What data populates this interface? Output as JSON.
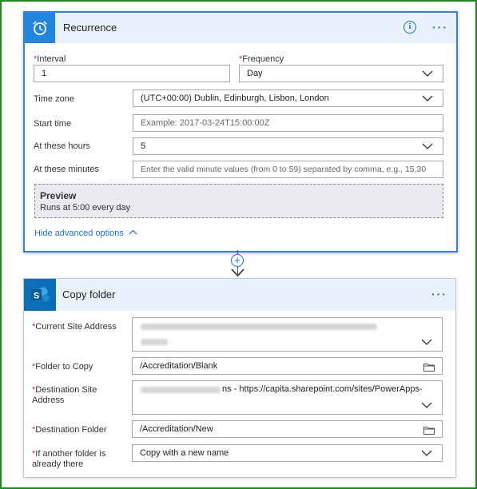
{
  "recurrence": {
    "title": "Recurrence",
    "more_label": "···",
    "info_label": "i",
    "interval": {
      "label": "Interval",
      "value": "1"
    },
    "frequency": {
      "label": "Frequency",
      "value": "Day"
    },
    "time_zone": {
      "label": "Time zone",
      "value": "(UTC+00:00) Dublin, Edinburgh, Lisbon, London"
    },
    "start_time": {
      "label": "Start time",
      "placeholder": "Example: 2017-03-24T15:00:00Z"
    },
    "at_hours": {
      "label": "At these hours",
      "value": "5"
    },
    "at_minutes": {
      "label": "At these minutes",
      "placeholder": "Enter the valid minute values (from 0 to 59) separated by comma, e.g., 15,30"
    },
    "preview": {
      "title": "Preview",
      "text": "Runs at 5:00 every day"
    },
    "advanced_link": "Hide advanced options"
  },
  "connector": {
    "add_label": "+"
  },
  "copy_folder": {
    "title": "Copy folder",
    "more_label": "···",
    "current_site": {
      "label": "Current Site Address"
    },
    "folder_to_copy": {
      "label": "Folder to Copy",
      "value": "/Accreditation/Blank"
    },
    "destination_site": {
      "label_line1": "Destination Site",
      "label_line2": "Address",
      "value_visible": "ns - https://capita.sharepoint.com/sites/PowerApps-"
    },
    "destination_folder": {
      "label": "Destination Folder",
      "value": "/Accreditation/New"
    },
    "if_exists": {
      "label_line1": "If another folder is",
      "label_line2": "already there",
      "value": "Copy with a new name"
    }
  },
  "colors": {
    "accent": "#1b6fd1",
    "recurrence_icon_bg": "#1f85de",
    "sharepoint_icon_bg": "#0a6fb8",
    "header_bg": "#e8f1fc",
    "required": "#d13438",
    "frame": "#1f8a1f"
  },
  "icons": {
    "recurrence": "alarm-clock-icon",
    "copy_folder": "sharepoint-icon",
    "dropdown": "chevron-down-icon",
    "folder": "folder-icon",
    "info": "info-icon",
    "advanced": "chevron-up-icon"
  }
}
